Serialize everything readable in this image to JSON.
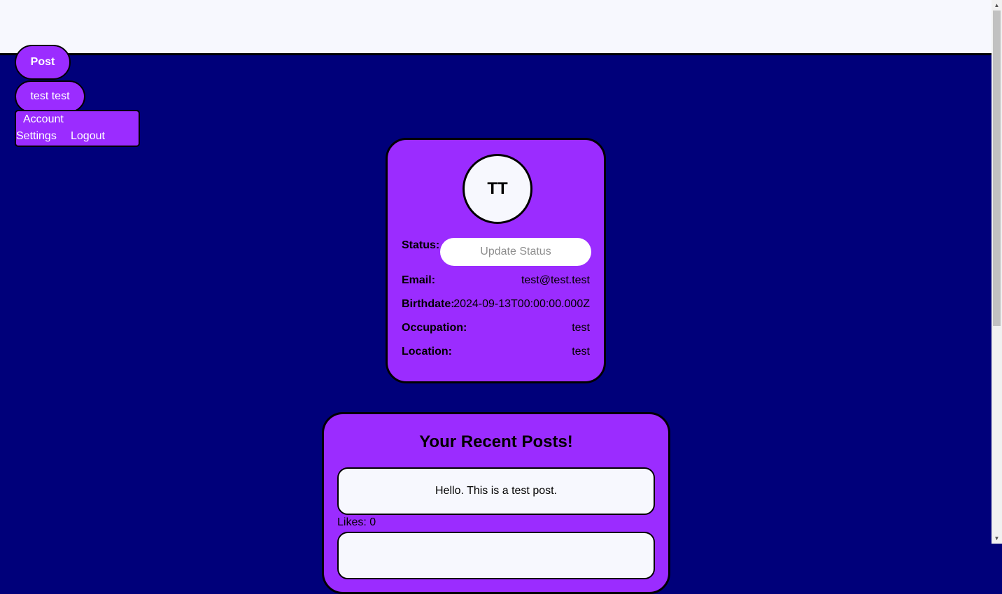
{
  "nav": {
    "post_label": "Post",
    "user_label": "test test",
    "menu": {
      "account_settings_line1": "Account",
      "account_settings_line2": "Settings",
      "logout": "Logout"
    }
  },
  "profile": {
    "initials": "TT",
    "status_label": "Status:",
    "status_placeholder": "Update Status",
    "status_value": "",
    "fields": [
      {
        "label": "Email:",
        "value": "test@test.test"
      },
      {
        "label": "Birthdate:",
        "value": "2024-09-13T00:00:00.000Z"
      },
      {
        "label": "Occupation:",
        "value": "test"
      },
      {
        "label": "Location:",
        "value": "test"
      }
    ]
  },
  "posts": {
    "title": "Your Recent Posts!",
    "items": [
      {
        "content": "Hello. This is a test post.",
        "likes": "Likes: 0"
      },
      {
        "content": "",
        "likes": ""
      }
    ]
  },
  "colors": {
    "background": "#00007a",
    "accent": "#9b2cff",
    "topbar": "#f7f8fe"
  }
}
